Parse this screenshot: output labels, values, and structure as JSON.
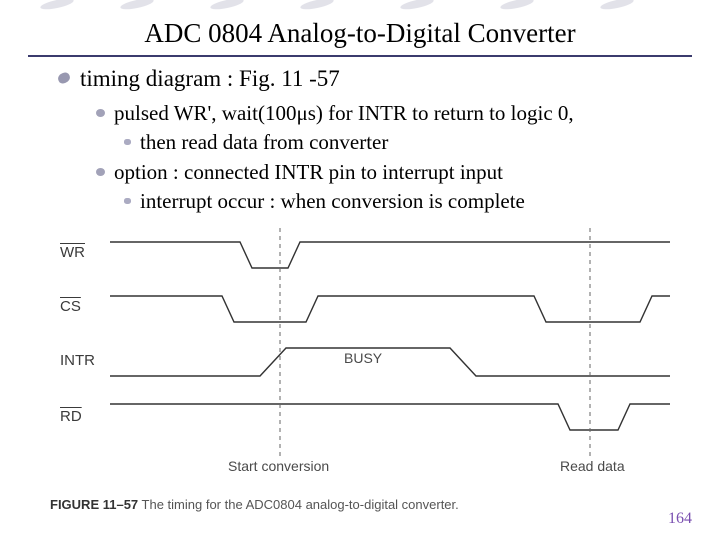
{
  "title": "ADC 0804 Analog-to-Digital Converter",
  "bullets": {
    "b1": "timing diagram : Fig. 11 -57",
    "b1_1": "pulsed WR',  wait(100μs) for INTR to return to logic 0,",
    "b1_1_1": "then read data from converter",
    "b1_2": "option : connected INTR pin to interrupt input",
    "b1_2_1": "interrupt occur : when conversion is complete"
  },
  "signals": {
    "wr": "WR",
    "cs": "CS",
    "intr": "INTR",
    "rd": "RD"
  },
  "annotations": {
    "busy": "BUSY",
    "start": "Start conversion",
    "read": "Read data"
  },
  "caption_lead": "FIGURE 11–57",
  "caption_rest": "   The timing for the ADC0804 analog-to-digital converter.",
  "page": "164",
  "chart_data": {
    "type": "line",
    "title": "ADC0804 timing diagram",
    "x": "time",
    "series": [
      {
        "name": "WR",
        "points": [
          [
            0,
            1
          ],
          [
            130,
            1
          ],
          [
            142,
            0
          ],
          [
            178,
            0
          ],
          [
            190,
            1
          ],
          [
            560,
            1
          ]
        ]
      },
      {
        "name": "CS",
        "points": [
          [
            0,
            1
          ],
          [
            112,
            1
          ],
          [
            124,
            0
          ],
          [
            196,
            0
          ],
          [
            208,
            1
          ],
          [
            424,
            1
          ],
          [
            436,
            0
          ],
          [
            530,
            0
          ],
          [
            542,
            1
          ],
          [
            560,
            1
          ]
        ]
      },
      {
        "name": "INTR",
        "points": [
          [
            0,
            0
          ],
          [
            150,
            0
          ],
          [
            176,
            1
          ],
          [
            340,
            1
          ],
          [
            366,
            0
          ],
          [
            560,
            0
          ]
        ]
      },
      {
        "name": "RD",
        "points": [
          [
            0,
            1
          ],
          [
            448,
            1
          ],
          [
            460,
            0
          ],
          [
            508,
            0
          ],
          [
            520,
            1
          ],
          [
            560,
            1
          ]
        ]
      }
    ],
    "vlines": [
      170,
      480
    ],
    "labels": [
      {
        "text": "BUSY",
        "x": 250,
        "series": "INTR"
      },
      {
        "text": "Start conversion",
        "x": 170,
        "pos": "bottom"
      },
      {
        "text": "Read data",
        "x": 480,
        "pos": "bottom"
      }
    ]
  }
}
